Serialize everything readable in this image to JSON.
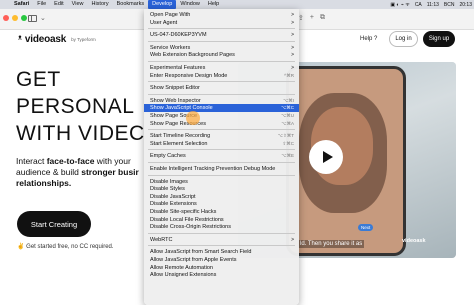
{
  "menubar": {
    "apple": "",
    "items": [
      "Safari",
      "File",
      "Edit",
      "View",
      "History",
      "Bookmarks",
      "Develop",
      "Window",
      "Help"
    ],
    "active": "Develop",
    "status": {
      "locale": "CA",
      "time": "11:13",
      "city": "BCN",
      "clock": "20:13"
    }
  },
  "header": {
    "brand": "videoask",
    "by": "by Typeform",
    "help": "Help ?",
    "login": "Log in",
    "signup": "Sign up"
  },
  "hero": {
    "line1": "GET",
    "line2": "PERSONAL",
    "line3": "WITH VIDEC",
    "sub_a": "Interact ",
    "sub_b": "face-to-face",
    "sub_c": " with your audience & build ",
    "sub_d": "stronger busir",
    "sub_e": "relationships.",
    "cta": "Start Creating",
    "note": "Get started free, no CC required."
  },
  "video": {
    "caption": "ld. Then you share it as",
    "badge": "videoask",
    "next": "Next"
  },
  "develop_menu": [
    {
      "label": "Open Page With",
      "arrow": ">"
    },
    {
      "label": "User Agent",
      "arrow": ">"
    },
    {
      "sep": true
    },
    {
      "label": "US-047-D60KEP3YVM",
      "arrow": ">"
    },
    {
      "sep": true
    },
    {
      "label": "Service Workers",
      "arrow": ">"
    },
    {
      "label": "Web Extension Background Pages",
      "arrow": ">"
    },
    {
      "sep": true
    },
    {
      "label": "Experimental Features",
      "arrow": ">"
    },
    {
      "label": "Enter Responsive Design Mode",
      "shortcut": "^⌘R"
    },
    {
      "sep": true
    },
    {
      "label": "Show Snippet Editor"
    },
    {
      "sep": true
    },
    {
      "label": "Show Web Inspector",
      "shortcut": "⌥⌘I"
    },
    {
      "label": "Show JavaScript Console",
      "shortcut": "⌥⌘C",
      "highlight": true
    },
    {
      "label": "Show Page Source",
      "shortcut": "⌥⌘U"
    },
    {
      "label": "Show Page Resources",
      "shortcut": "⌥⌘A"
    },
    {
      "sep": true
    },
    {
      "label": "Start Timeline Recording",
      "shortcut": "⌥⇧⌘T"
    },
    {
      "label": "Start Element Selection",
      "shortcut": "⇧⌘C"
    },
    {
      "sep": true
    },
    {
      "label": "Empty Caches",
      "shortcut": "⌥⌘E"
    },
    {
      "sep": true
    },
    {
      "label": "Enable Intelligent Tracking Prevention Debug Mode"
    },
    {
      "sep": true
    },
    {
      "label": "Disable Images"
    },
    {
      "label": "Disable Styles"
    },
    {
      "label": "Disable JavaScript"
    },
    {
      "label": "Disable Extensions"
    },
    {
      "label": "Disable Site-specific Hacks"
    },
    {
      "label": "Disable Local File Restrictions"
    },
    {
      "label": "Disable Cross-Origin Restrictions"
    },
    {
      "sep": true
    },
    {
      "label": "WebRTC",
      "arrow": ">"
    },
    {
      "sep": true
    },
    {
      "label": "Allow JavaScript from Smart Search Field"
    },
    {
      "label": "Allow JavaScript from Apple Events"
    },
    {
      "label": "Allow Remote Automation"
    },
    {
      "label": "Allow Unsigned Extensions"
    }
  ],
  "colors": {
    "menu_highlight": "#2a62d8",
    "black_button": "#111111"
  }
}
